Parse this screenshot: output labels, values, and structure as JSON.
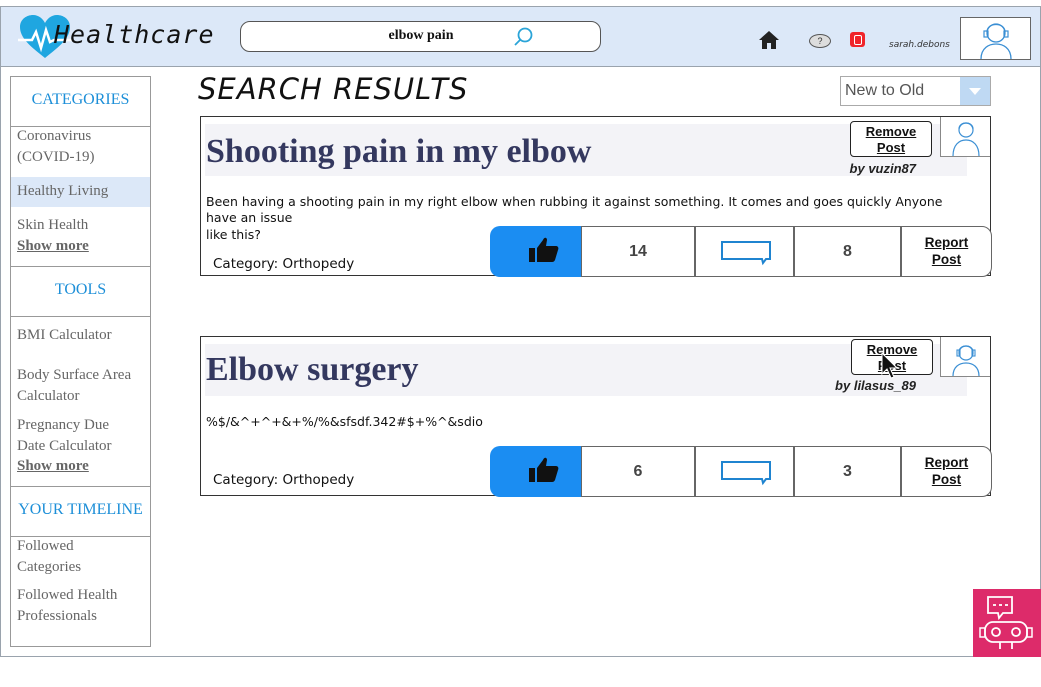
{
  "app": {
    "brand": "Healthcare",
    "search_value": "elbow pain",
    "username": "sarah.debons"
  },
  "sidebar": {
    "categories_heading": "CATEGORIES",
    "categories": [
      "Coronavirus (COVID-19)",
      "Healthy Living",
      "Skin Health"
    ],
    "show_more": "Show more",
    "tools_heading": "TOOLS",
    "tools": [
      "BMI Calculator",
      "Body Surface Area Calculator",
      "Pregnancy Due Date Calculator"
    ],
    "timeline_heading": "YOUR TIMELINE",
    "timeline": [
      "Followed Categories",
      "Followed Health Professionals"
    ]
  },
  "main": {
    "title": "SEARCH RESULTS",
    "sort_value": "New to Old"
  },
  "posts": [
    {
      "title": "Shooting pain in my elbow",
      "author": "by vuzin87",
      "body_line1": "Been having a shooting pain in my right elbow when rubbing it against something. It comes and goes quickly Anyone",
      "body_line2": "have an issue",
      "body_line3": "like this?",
      "category": "Category: Orthopedy",
      "likes": "14",
      "comments": "8",
      "remove_label_1": "Remove",
      "remove_label_2": "Post",
      "report_label_1": "Report",
      "report_label_2": "Post"
    },
    {
      "title": "Elbow surgery",
      "author": "by lilasus_89",
      "body_line1": "%$/&^+^+&+%/%&sfsdf.342#$+%^&sdio",
      "category": "Category: Orthopedy",
      "likes": "6",
      "comments": "3",
      "remove_label_1": "Remove",
      "remove_label_2": "Post",
      "report_label_1": "Report",
      "report_label_2": "Post"
    }
  ],
  "colors": {
    "header_bg": "#dce8f8",
    "accent_blue": "#1b8df2",
    "sidebar_heading": "#1d8fd8",
    "post_title": "#34385f",
    "bot_bg": "#dd2b6a"
  }
}
